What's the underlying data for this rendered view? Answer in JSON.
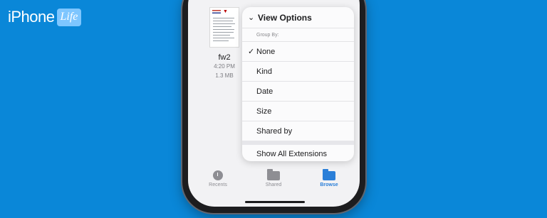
{
  "brand": {
    "name": "iPhone",
    "suffix": "Life"
  },
  "file": {
    "name": "fw2",
    "time": "4:20 PM",
    "size": "1.3 MB"
  },
  "menu": {
    "title": "View Options",
    "group_label": "Group By:",
    "items": [
      {
        "label": "None",
        "checked": true
      },
      {
        "label": "Kind"
      },
      {
        "label": "Date"
      },
      {
        "label": "Size"
      },
      {
        "label": "Shared by"
      }
    ],
    "extensions_label": "Show All Extensions"
  },
  "tabs": [
    {
      "label": "Recents",
      "icon": "clock-icon",
      "active": false
    },
    {
      "label": "Shared",
      "icon": "shared-folder-icon",
      "active": false
    },
    {
      "label": "Browse",
      "icon": "folder-icon",
      "active": true
    }
  ],
  "colors": {
    "background": "#0a87d8",
    "accent": "#2b7fd8",
    "inactive": "#8e8e93"
  }
}
